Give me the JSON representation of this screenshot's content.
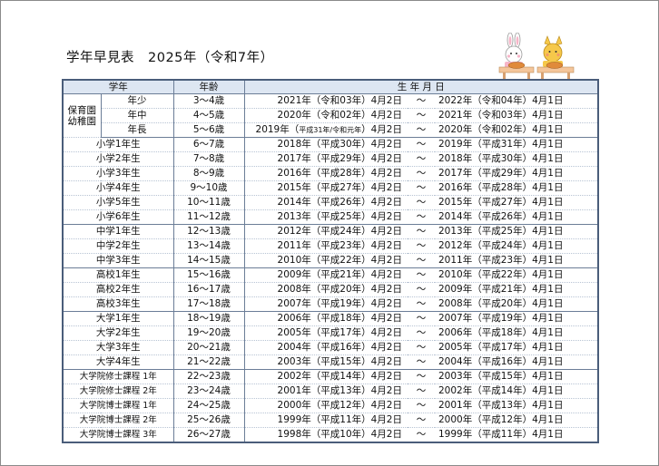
{
  "title": "学年早見表　2025年（令和7年）",
  "headers": {
    "grade": "学年",
    "age": "年齢",
    "birth": "生 年 月 日"
  },
  "preschool_group": "保育園\n幼稚園",
  "tilde": "～",
  "rows": [
    {
      "grade": "年少",
      "age": "3～4歳",
      "from": "2021年（令和03年）4月2日",
      "to": "2022年（令和04年）4月1日"
    },
    {
      "grade": "年中",
      "age": "4～5歳",
      "from": "2020年（令和02年）4月2日",
      "to": "2021年（令和03年）4月1日"
    },
    {
      "grade": "年長",
      "age": "5～6歳",
      "from": "2019年（平成31年/令和元年）4月2日",
      "to": "2020年（令和02年）4月1日"
    },
    {
      "grade": "小学1年生",
      "age": "6～7歳",
      "from": "2018年（平成30年）4月2日",
      "to": "2019年（平成31年）4月1日"
    },
    {
      "grade": "小学2年生",
      "age": "7～8歳",
      "from": "2017年（平成29年）4月2日",
      "to": "2018年（平成30年）4月1日"
    },
    {
      "grade": "小学3年生",
      "age": "8～9歳",
      "from": "2016年（平成28年）4月2日",
      "to": "2017年（平成29年）4月1日"
    },
    {
      "grade": "小学4年生",
      "age": "9～10歳",
      "from": "2015年（平成27年）4月2日",
      "to": "2016年（平成28年）4月1日"
    },
    {
      "grade": "小学5年生",
      "age": "10～11歳",
      "from": "2014年（平成26年）4月2日",
      "to": "2015年（平成27年）4月1日"
    },
    {
      "grade": "小学6年生",
      "age": "11～12歳",
      "from": "2013年（平成25年）4月2日",
      "to": "2014年（平成26年）4月1日"
    },
    {
      "grade": "中学1年生",
      "age": "12～13歳",
      "from": "2012年（平成24年）4月2日",
      "to": "2013年（平成25年）4月1日"
    },
    {
      "grade": "中学2年生",
      "age": "13～14歳",
      "from": "2011年（平成23年）4月2日",
      "to": "2012年（平成24年）4月1日"
    },
    {
      "grade": "中学3年生",
      "age": "14～15歳",
      "from": "2010年（平成22年）4月2日",
      "to": "2011年（平成23年）4月1日"
    },
    {
      "grade": "高校1年生",
      "age": "15～16歳",
      "from": "2009年（平成21年）4月2日",
      "to": "2010年（平成22年）4月1日"
    },
    {
      "grade": "高校2年生",
      "age": "16～17歳",
      "from": "2008年（平成20年）4月2日",
      "to": "2009年（平成21年）4月1日"
    },
    {
      "grade": "高校3年生",
      "age": "17～18歳",
      "from": "2007年（平成19年）4月2日",
      "to": "2008年（平成20年）4月1日"
    },
    {
      "grade": "大学1年生",
      "age": "18～19歳",
      "from": "2006年（平成18年）4月2日",
      "to": "2007年（平成19年）4月1日"
    },
    {
      "grade": "大学2年生",
      "age": "19～20歳",
      "from": "2005年（平成17年）4月2日",
      "to": "2006年（平成18年）4月1日"
    },
    {
      "grade": "大学3年生",
      "age": "20～21歳",
      "from": "2004年（平成16年）4月2日",
      "to": "2005年（平成17年）4月1日"
    },
    {
      "grade": "大学4年生",
      "age": "21～22歳",
      "from": "2003年（平成15年）4月2日",
      "to": "2004年（平成16年）4月1日"
    },
    {
      "grade": "大学院修士課程 1年",
      "age": "22～23歳",
      "from": "2002年（平成14年）4月2日",
      "to": "2003年（平成15年）4月1日"
    },
    {
      "grade": "大学院修士課程 2年",
      "age": "23～24歳",
      "from": "2001年（平成13年）4月2日",
      "to": "2002年（平成14年）4月1日"
    },
    {
      "grade": "大学院博士課程 1年",
      "age": "24～25歳",
      "from": "2000年（平成12年）4月2日",
      "to": "2001年（平成13年）4月1日"
    },
    {
      "grade": "大学院博士課程 2年",
      "age": "25～26歳",
      "from": "1999年（平成11年）4月2日",
      "to": "2000年（平成12年）4月1日"
    },
    {
      "grade": "大学院博士課程 3年",
      "age": "26～27歳",
      "from": "1998年（平成10年）4月2日",
      "to": "1999年（平成11年）4月1日"
    }
  ],
  "illustration": {
    "icon": "rabbit-and-cat-at-desks-icon",
    "colors": {
      "desk": "#f4c59a",
      "rabbit": "#f7b5c8",
      "cat": "#f6c84a",
      "pie": "#e08a3a"
    }
  }
}
